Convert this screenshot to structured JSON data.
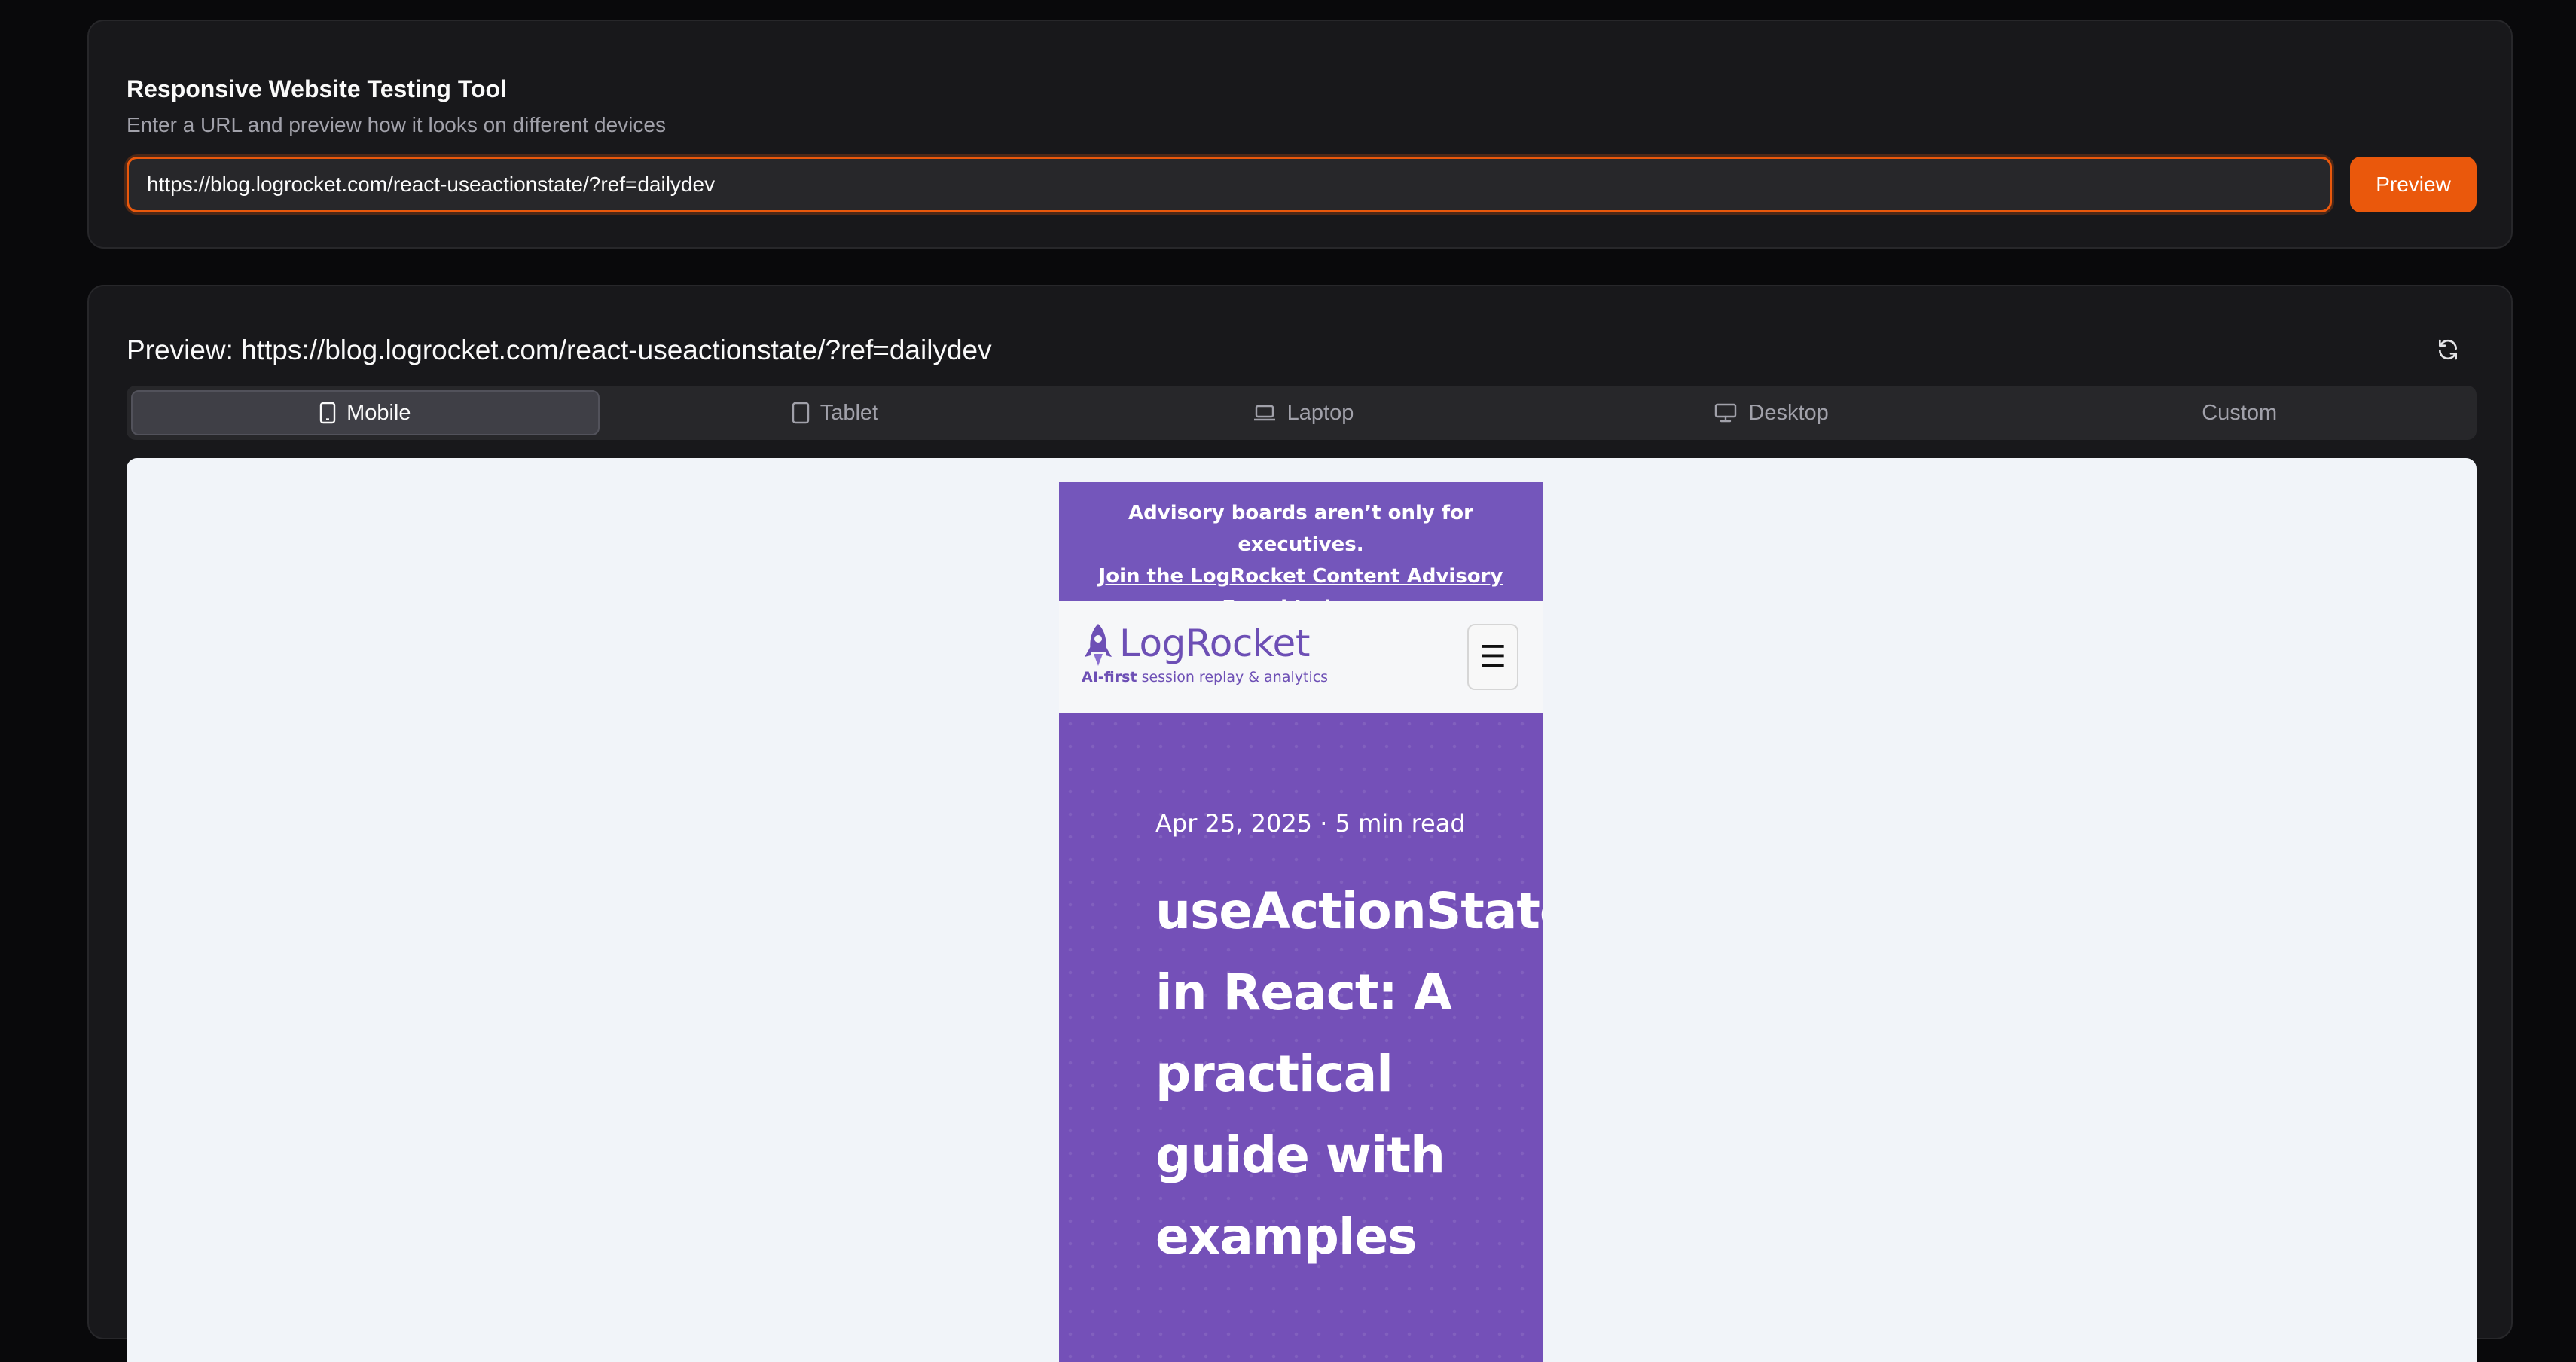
{
  "tool": {
    "title": "Responsive Website Testing Tool",
    "subtitle": "Enter a URL and preview how it looks on different devices",
    "url_value": "https://blog.logrocket.com/react-useactionstate/?ref=dailydev",
    "preview_button": "Preview"
  },
  "preview": {
    "title": "Preview: https://blog.logrocket.com/react-useactionstate/?ref=dailydev",
    "refresh_icon": "refresh-icon",
    "tabs": [
      {
        "label": "Mobile",
        "icon": "smartphone-icon",
        "active": true
      },
      {
        "label": "Tablet",
        "icon": "tablet-icon",
        "active": false
      },
      {
        "label": "Laptop",
        "icon": "laptop-icon",
        "active": false
      },
      {
        "label": "Desktop",
        "icon": "monitor-icon",
        "active": false
      },
      {
        "label": "Custom",
        "icon": "",
        "active": false
      }
    ]
  },
  "site": {
    "banner_text": "Advisory boards aren’t only for executives.",
    "banner_link": "Join the LogRocket Content Advisory Board today",
    "banner_arrow": "→",
    "logo_text": "LogRocket",
    "logo_tag_bold": "AI-first",
    "logo_tag_rest": "session replay & analytics",
    "menu_icon": "☰",
    "date": "Apr 25, 2025",
    "separator": "·",
    "read_time": "5 min read",
    "headline_lines": [
      "useActionState",
      "in React: A",
      "practical",
      "guide with",
      "examples"
    ]
  },
  "colors": {
    "accent": "#ea580c",
    "brand_purple": "#7450b8",
    "background": "#09090b",
    "card": "#18181b"
  }
}
